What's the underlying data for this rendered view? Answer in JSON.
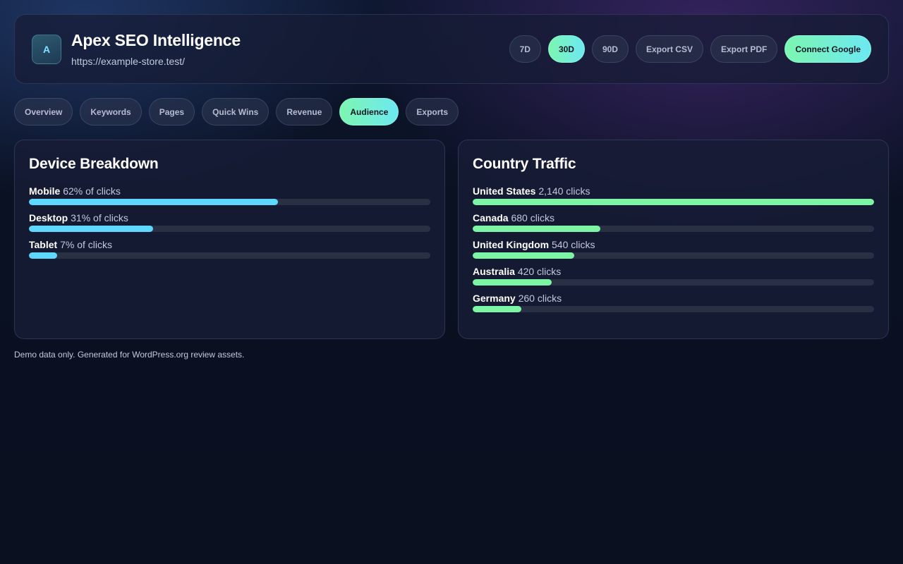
{
  "header": {
    "logo_letter": "A",
    "title": "Apex SEO Intelligence",
    "url": "https://example-store.test/",
    "actions": [
      {
        "label": "7D",
        "active": false
      },
      {
        "label": "30D",
        "active": true
      },
      {
        "label": "90D",
        "active": false
      },
      {
        "label": "Export CSV",
        "active": false
      },
      {
        "label": "Export PDF",
        "active": false
      },
      {
        "label": "Connect Google",
        "active": true
      }
    ]
  },
  "tabs": [
    {
      "label": "Overview",
      "active": false
    },
    {
      "label": "Keywords",
      "active": false
    },
    {
      "label": "Pages",
      "active": false
    },
    {
      "label": "Quick Wins",
      "active": false
    },
    {
      "label": "Revenue",
      "active": false
    },
    {
      "label": "Audience",
      "active": true
    },
    {
      "label": "Exports",
      "active": false
    }
  ],
  "device": {
    "title": "Device Breakdown",
    "rows": [
      {
        "name": "Mobile",
        "detail": "62% of clicks",
        "percent": 62
      },
      {
        "name": "Desktop",
        "detail": "31% of clicks",
        "percent": 31
      },
      {
        "name": "Tablet",
        "detail": "7% of clicks",
        "percent": 7
      }
    ]
  },
  "country": {
    "title": "Country Traffic",
    "rows": [
      {
        "name": "United States",
        "detail": "2,140 clicks",
        "clicks": 2140
      },
      {
        "name": "Canada",
        "detail": "680 clicks",
        "clicks": 680
      },
      {
        "name": "United Kingdom",
        "detail": "540 clicks",
        "clicks": 540
      },
      {
        "name": "Australia",
        "detail": "420 clicks",
        "clicks": 420
      },
      {
        "name": "Germany",
        "detail": "260 clicks",
        "clicks": 260
      }
    ]
  },
  "footer": "Demo data only. Generated for WordPress.org review assets.",
  "colors": {
    "accent_green": "#7cf5a4",
    "accent_cyan": "#5fd8ff",
    "background": "#0a1020"
  }
}
